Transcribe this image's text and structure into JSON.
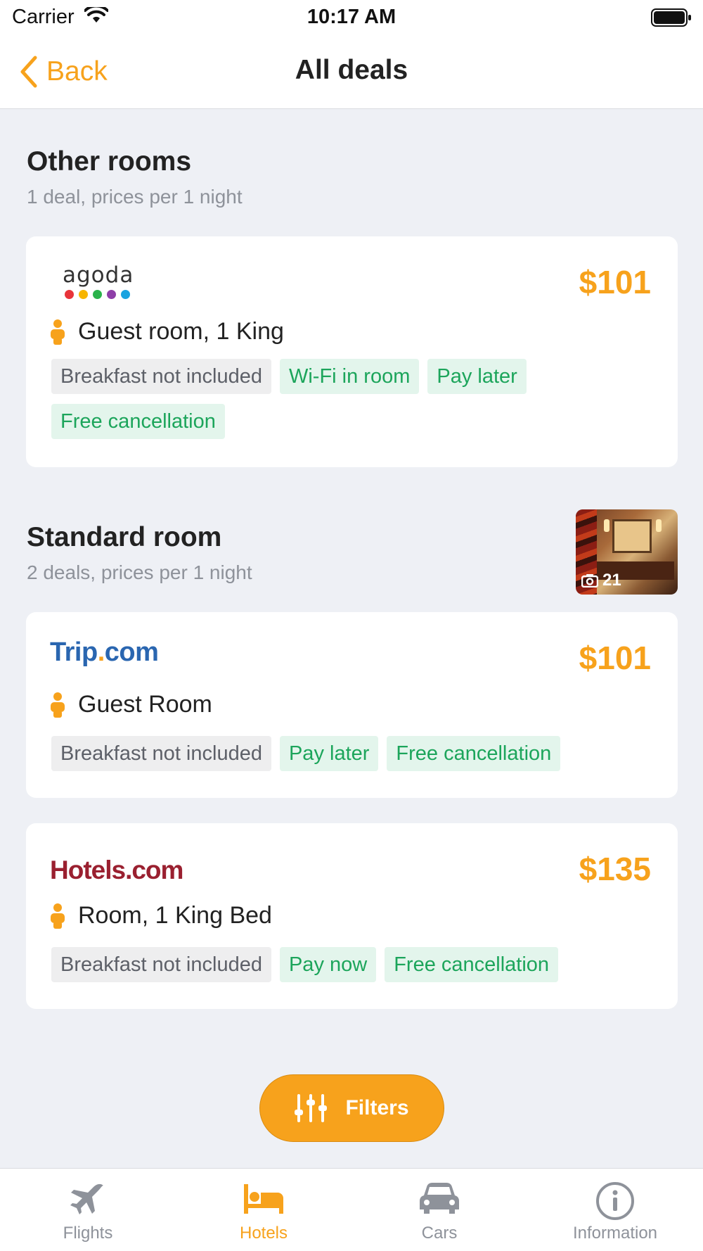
{
  "status_bar": {
    "carrier": "Carrier",
    "time": "10:17 AM"
  },
  "nav": {
    "back_label": "Back",
    "title": "All deals"
  },
  "sections": [
    {
      "title": "Other rooms",
      "subtitle": "1 deal, prices per 1 night",
      "deals": [
        {
          "provider": "agoda",
          "price": "$101",
          "room": "Guest room, 1 King",
          "tags": [
            "Breakfast not included",
            "Wi-Fi in room",
            "Pay later",
            "Free cancellation"
          ]
        }
      ]
    },
    {
      "title": "Standard room",
      "subtitle": "2 deals, prices per 1 night",
      "photo_count": "21",
      "deals": [
        {
          "provider": "Trip.com",
          "price": "$101",
          "room": "Guest Room",
          "tags": [
            "Breakfast not included",
            "Pay later",
            "Free cancellation"
          ]
        },
        {
          "provider": "Hotels.com",
          "price": "$135",
          "room": "Room, 1 King Bed",
          "tags": [
            "Breakfast not included",
            "Pay now",
            "Free cancellation"
          ]
        }
      ]
    }
  ],
  "filters_label": "Filters",
  "tabs": [
    {
      "label": "Flights",
      "icon": "plane-icon"
    },
    {
      "label": "Hotels",
      "icon": "bed-icon",
      "active": true
    },
    {
      "label": "Cars",
      "icon": "car-icon"
    },
    {
      "label": "Information",
      "icon": "info-icon"
    }
  ],
  "colors": {
    "accent": "#f7a21c",
    "tag_green": "#1ca55b",
    "tag_green_bg": "#e3f5ec",
    "background": "#eef0f5"
  }
}
